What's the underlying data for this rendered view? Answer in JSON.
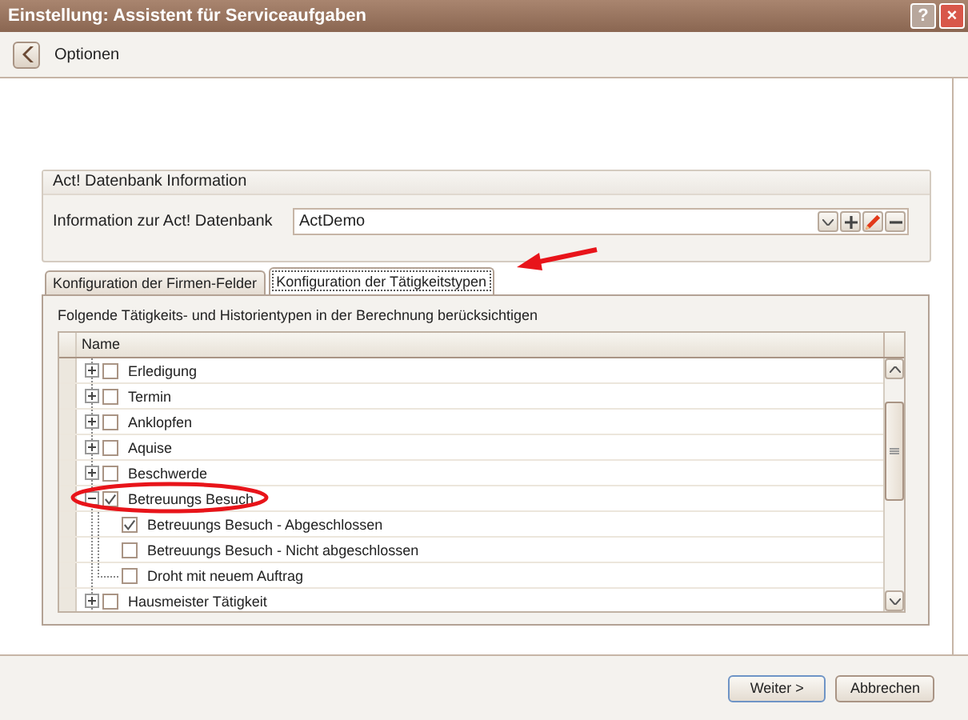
{
  "window": {
    "title": "Einstellung: Assistent für Serviceaufgaben",
    "help": "?",
    "close": "×"
  },
  "header": {
    "title": "Optionen"
  },
  "database_group": {
    "title": "Act! Datenbank Information",
    "label": "Information zur Act! Datenbank",
    "value": "ActDemo"
  },
  "tabs": [
    {
      "label": "Konfiguration der Firmen-Felder",
      "selected": false
    },
    {
      "label": "Konfiguration der Tätigkeitstypen",
      "selected": true
    }
  ],
  "panel": {
    "description": "Folgende Tätigkeits- und Historientypen in der Berechnung berücksichtigen",
    "columns": [
      "Name"
    ],
    "tree": [
      {
        "name": "Erledigung",
        "checked": false,
        "expanded": false
      },
      {
        "name": "Termin",
        "checked": false,
        "expanded": false
      },
      {
        "name": "Anklopfen",
        "checked": false,
        "expanded": false
      },
      {
        "name": "Aquise",
        "checked": false,
        "expanded": false
      },
      {
        "name": "Beschwerde",
        "checked": false,
        "expanded": false
      },
      {
        "name": "Betreuungs Besuch",
        "checked": true,
        "expanded": true,
        "children": [
          {
            "name": "Betreuungs Besuch - Abgeschlossen",
            "checked": true
          },
          {
            "name": "Betreuungs Besuch - Nicht abgeschlossen",
            "checked": false
          },
          {
            "name": "Droht mit neuem Auftrag",
            "checked": false
          }
        ]
      },
      {
        "name": "Hausmeister Tätigkeit",
        "checked": false,
        "expanded": false
      }
    ]
  },
  "buttons": [
    {
      "label": "Weiter >",
      "default": true
    },
    {
      "label": "Abbrechen",
      "default": false
    }
  ]
}
